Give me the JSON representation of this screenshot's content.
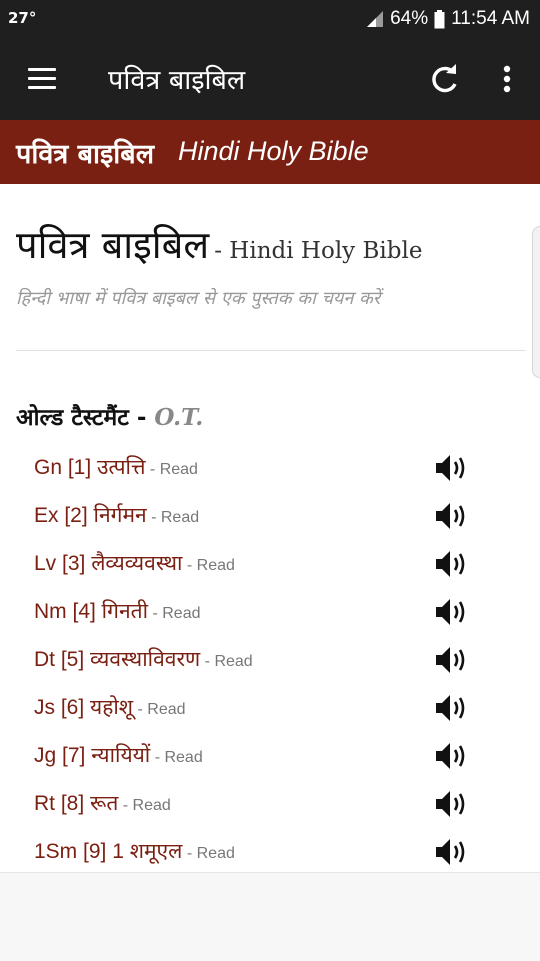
{
  "status": {
    "temperature": "27°",
    "battery": "64%",
    "time": "11:54 AM"
  },
  "toolbar": {
    "title": "पवित्र बाइबिल"
  },
  "banner": {
    "hindi": "पवित्र बाइबिल",
    "english": "Hindi Holy Bible"
  },
  "page": {
    "heading_hindi": "पवित्र बाइबिल",
    "heading_english": "- Hindi Holy Bible",
    "subtitle": "हिन्दी भाषा में पवित्र बाइबल से एक पुस्तक का चयन करें"
  },
  "section": {
    "title": "ओल्ड टैस्टमैंट",
    "dash": " - ",
    "abbr": "O.T."
  },
  "books": [
    {
      "label": "Gn [1] उत्पत्ति",
      "read": " - Read"
    },
    {
      "label": "Ex [2] निर्गमन",
      "read": " - Read"
    },
    {
      "label": "Lv [3] लैव्यव्यवस्था",
      "read": " - Read"
    },
    {
      "label": "Nm [4] गिनती",
      "read": " - Read"
    },
    {
      "label": "Dt [5] व्यवस्थाविवरण",
      "read": " - Read"
    },
    {
      "label": "Js [6] यहोशू",
      "read": " - Read"
    },
    {
      "label": "Jg [7] न्यायियों",
      "read": " - Read"
    },
    {
      "label": "Rt [8] रूत",
      "read": " - Read"
    },
    {
      "label": "1Sm [9] 1 शमूएल",
      "read": " - Read"
    }
  ]
}
